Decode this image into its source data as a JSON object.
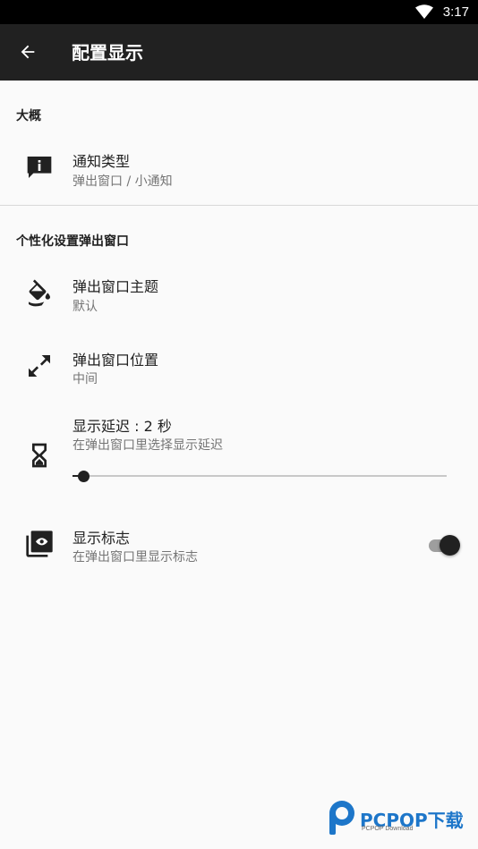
{
  "status_bar": {
    "time": "3:17",
    "wifi_icon": "wifi-icon"
  },
  "toolbar": {
    "title": "配置显示",
    "back_icon": "arrow-left-icon"
  },
  "sections": {
    "general": {
      "header": "大概",
      "notification_type": {
        "title": "通知类型",
        "summary": "弹出窗口 / 小通知",
        "icon": "info-message-icon"
      }
    },
    "popup": {
      "header": "个性化设置弹出窗口",
      "theme": {
        "title": "弹出窗口主题",
        "summary": "默认",
        "icon": "paint-bucket-icon"
      },
      "position": {
        "title": "弹出窗口位置",
        "summary": "中间",
        "icon": "expand-diagonal-icon"
      },
      "delay": {
        "title": "显示延迟 : 2 秒",
        "summary": "在弹出窗口里选择显示延迟",
        "icon": "hourglass-icon",
        "value_fraction": 0.03
      },
      "logo": {
        "title": "显示标志",
        "summary": "在弹出窗口里显示标志",
        "icon": "logo-preview-icon",
        "enabled": true
      }
    }
  },
  "watermark": {
    "brand": "PCPOP下载",
    "sub": "PCPOP Download"
  },
  "colors": {
    "toolbar": "#212121",
    "background": "#fafafa",
    "accent": "#212121",
    "watermark": "#1d76c9"
  }
}
